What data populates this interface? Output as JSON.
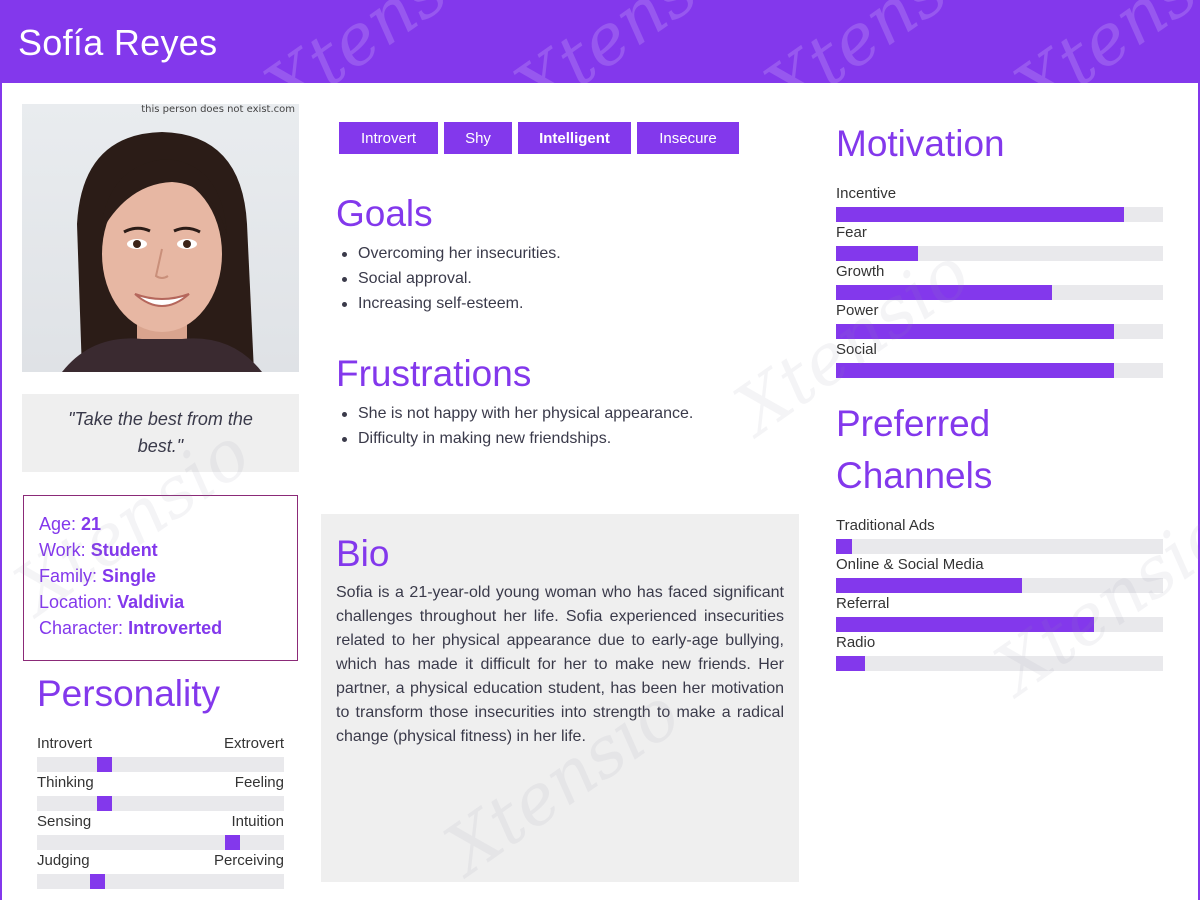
{
  "header": {
    "name": "Sofía Reyes"
  },
  "photo": {
    "caption": "this person does not exist.com"
  },
  "quote": "\"Take the best from the best.\"",
  "info": [
    {
      "label": "Age:",
      "value": "21"
    },
    {
      "label": "Work:",
      "value": "Student"
    },
    {
      "label": "Family:",
      "value": "Single"
    },
    {
      "label": "Location:",
      "value": "Valdivia"
    },
    {
      "label": "Character:",
      "value": "Introverted"
    }
  ],
  "personality": {
    "title": "Personality",
    "scales": [
      {
        "left": "Introvert",
        "right": "Extrovert",
        "value": 0.26
      },
      {
        "left": "Thinking",
        "right": "Feeling",
        "value": 0.26
      },
      {
        "left": "Sensing",
        "right": "Intuition",
        "value": 0.81
      },
      {
        "left": "Judging",
        "right": "Perceiving",
        "value": 0.23
      }
    ]
  },
  "tags": [
    {
      "label": "Introvert",
      "bold": false
    },
    {
      "label": "Shy",
      "bold": false
    },
    {
      "label": "Intelligent",
      "bold": true
    },
    {
      "label": "Insecure",
      "bold": false
    }
  ],
  "goals": {
    "title": "Goals",
    "items": [
      "Overcoming her insecurities.",
      "Social approval.",
      "Increasing self-esteem."
    ]
  },
  "frustrations": {
    "title": "Frustrations",
    "items": [
      "She is not happy with her physical appearance.",
      "Difficulty in making new friendships."
    ]
  },
  "bio": {
    "title": "Bio",
    "text": "Sofia is a 21-year-old young woman who has faced significant challenges throughout her life. Sofia experienced insecurities related to her physical appearance due to early-age bullying, which has made it difficult for her to make new friends. Her partner, a physical education student, has been her motivation to transform those insecurities into strength to make a radical change (physical fitness) in her life."
  },
  "motivation": {
    "title": "Motivation",
    "items": [
      {
        "label": "Incentive",
        "value": 0.88
      },
      {
        "label": "Fear",
        "value": 0.25
      },
      {
        "label": "Growth",
        "value": 0.66
      },
      {
        "label": "Power",
        "value": 0.85
      },
      {
        "label": "Social",
        "value": 0.85
      }
    ]
  },
  "channels": {
    "title_line1": "Preferred",
    "title_line2": "Channels",
    "items": [
      {
        "label": "Traditional Ads",
        "value": 0.05
      },
      {
        "label": "Online & Social Media",
        "value": 0.57
      },
      {
        "label": "Referral",
        "value": 0.79
      },
      {
        "label": "Radio",
        "value": 0.09
      }
    ]
  },
  "colors": {
    "accent": "#8338ec",
    "track": "#e9e9ec",
    "panel": "#efefef",
    "border": "#8b2a78"
  }
}
